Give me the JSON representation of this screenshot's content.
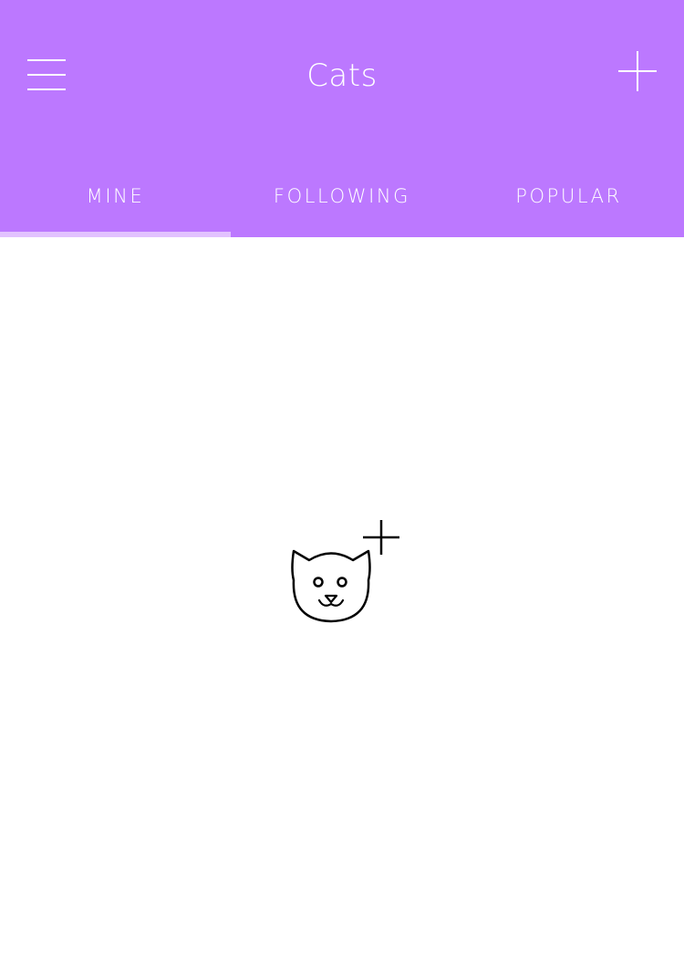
{
  "header": {
    "title": "Cats",
    "background_color": "#bc78ff",
    "menu_icon": "hamburger-menu-icon",
    "add_icon": "plus-icon"
  },
  "tabs": [
    {
      "label": "MINE",
      "selected": true
    },
    {
      "label": "FOLLOWING",
      "selected": false
    },
    {
      "label": "POPULAR",
      "selected": false
    }
  ],
  "tab_indicator_color": "#e2c2ff",
  "empty_state": {
    "icon": "add-cat-icon"
  }
}
